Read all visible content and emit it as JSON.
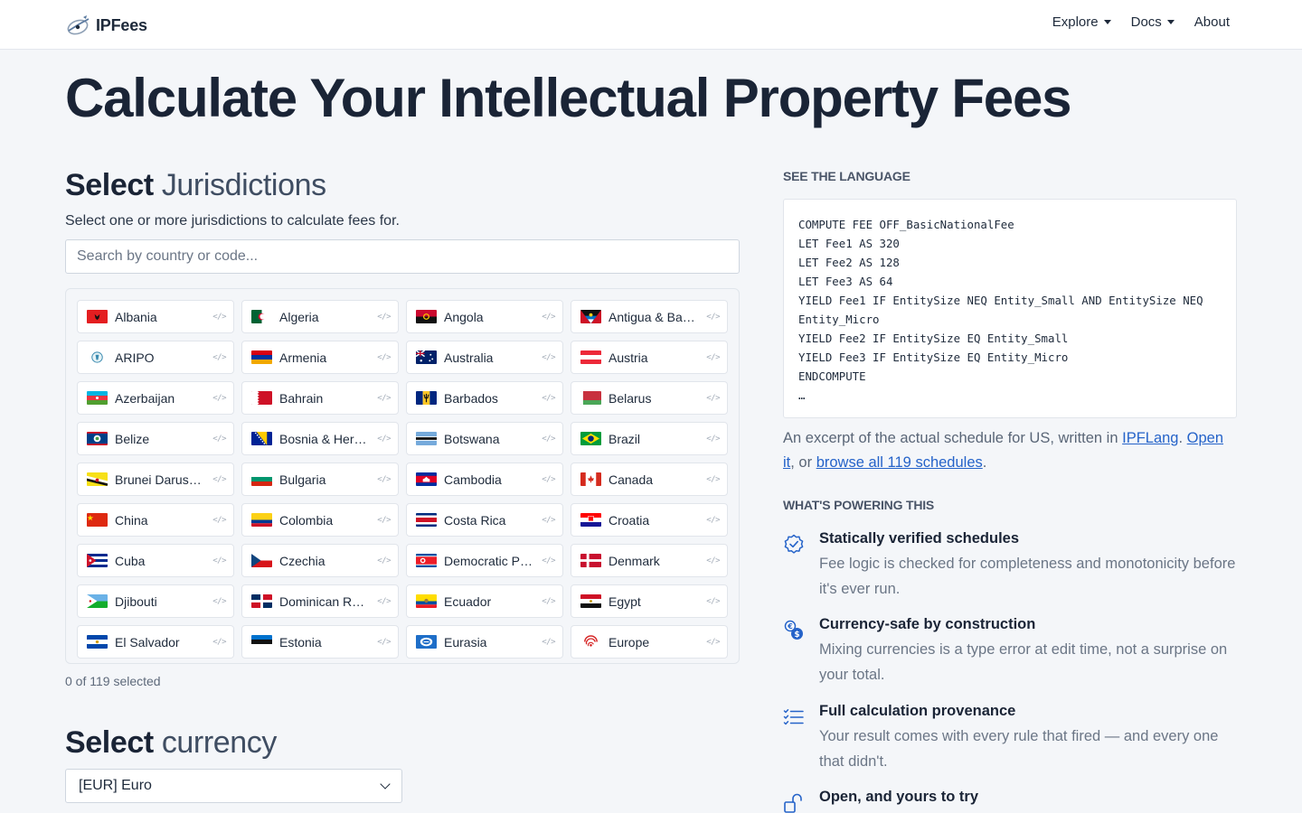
{
  "brand": {
    "name": "IPFees"
  },
  "nav": {
    "explore": "Explore",
    "docs": "Docs",
    "about": "About"
  },
  "hero": {
    "title": "Calculate Your Intellectual Property Fees"
  },
  "jurisdictions": {
    "title_strong": "Select",
    "title_accent": "Jurisdictions",
    "subtitle": "Select one or more jurisdictions to calculate fees for.",
    "search_placeholder": "Search by country or code...",
    "items": [
      "Albania",
      "Algeria",
      "Angola",
      "Antigua & Barbuda",
      "ARIPO",
      "Armenia",
      "Australia",
      "Austria",
      "Azerbaijan",
      "Bahrain",
      "Barbados",
      "Belarus",
      "Belize",
      "Bosnia & Herzegovina",
      "Botswana",
      "Brazil",
      "Brunei Darussalam",
      "Bulgaria",
      "Cambodia",
      "Canada",
      "China",
      "Colombia",
      "Costa Rica",
      "Croatia",
      "Cuba",
      "Czechia",
      "Democratic People's Republic of Korea",
      "Denmark",
      "Djibouti",
      "Dominican Republic",
      "Ecuador",
      "Egypt",
      "El Salvador",
      "Estonia",
      "Eurasia",
      "Europe"
    ],
    "count_text": "0 of 119 selected"
  },
  "currency": {
    "title_strong": "Select",
    "title_accent": "currency",
    "selected": "[EUR] Euro"
  },
  "language": {
    "label": "SEE THE LANGUAGE",
    "code": "COMPUTE FEE OFF_BasicNationalFee\nLET Fee1 AS 320\nLET Fee2 AS 128\nLET Fee3 AS 64\nYIELD Fee1 IF EntitySize NEQ Entity_Small AND EntitySize NEQ Entity_Micro\nYIELD Fee2 IF EntitySize EQ Entity_Small\nYIELD Fee3 IF EntitySize EQ Entity_Micro\nENDCOMPUTE\n…",
    "excerpt_prefix": "An excerpt of the actual schedule for US, written in ",
    "link_lang": "IPFLang",
    "sep1": ". ",
    "link_open": "Open it",
    "sep2": ", or ",
    "link_browse": "browse all 119 schedules",
    "suffix": "."
  },
  "powering": {
    "label": "WHAT'S POWERING THIS",
    "features": [
      {
        "icon": "verified-badge-icon",
        "title": "Statically verified schedules",
        "desc": "Fee logic is checked for completeness and monotonicity before it's ever run."
      },
      {
        "icon": "currency-exchange-icon",
        "title": "Currency-safe by construction",
        "desc": "Mixing currencies is a type error at edit time, not a surprise on your total."
      },
      {
        "icon": "checklist-icon",
        "title": "Full calculation provenance",
        "desc": "Your result comes with every rule that fired — and every one that didn't."
      },
      {
        "icon": "unlock-icon",
        "title": "Open, and yours to try",
        "desc": ""
      }
    ]
  }
}
